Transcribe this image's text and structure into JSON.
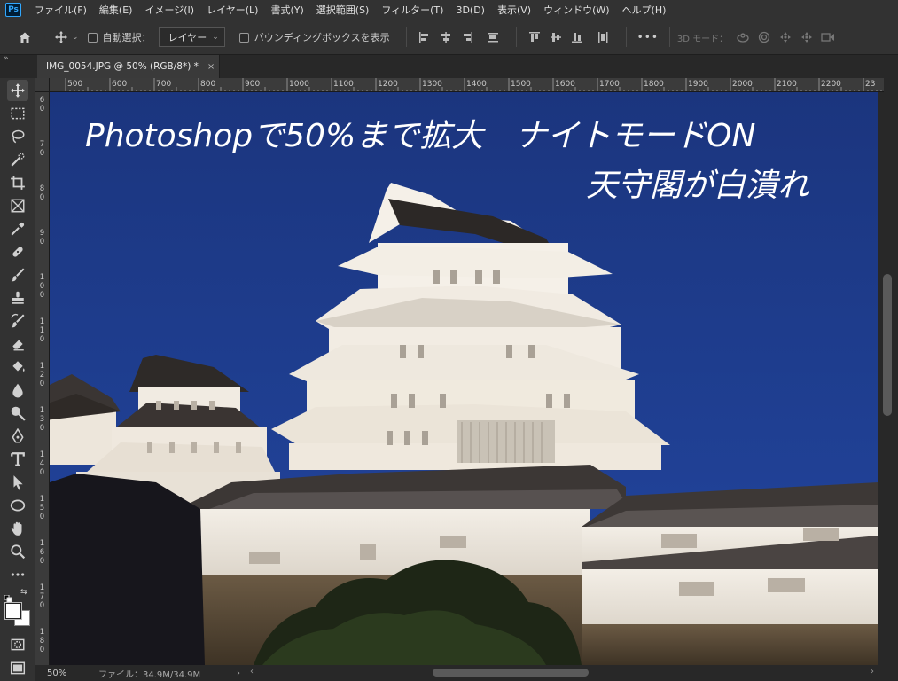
{
  "app": {
    "logo_text": "Ps",
    "menu": [
      "ファイル(F)",
      "編集(E)",
      "イメージ(I)",
      "レイヤー(L)",
      "書式(Y)",
      "選択範囲(S)",
      "フィルター(T)",
      "3D(D)",
      "表示(V)",
      "ウィンドウ(W)",
      "ヘルプ(H)"
    ]
  },
  "options": {
    "auto_select_label": "自動選択：",
    "auto_select_target": "レイヤー",
    "bounding_box_label": "バウンディングボックスを表示",
    "more": "•••",
    "mode_3d_label": "3D モード："
  },
  "document": {
    "tab_title": "IMG_0054.JPG @ 50% (RGB/8*) *",
    "close_glyph": "×",
    "overlay_title": "Photoshopで50%まで拡大　ナイトモードON",
    "overlay_subtitle": "天守閣が白潰れ"
  },
  "rulers": {
    "top_labels": [
      "500",
      "600",
      "700",
      "800",
      "900",
      "1000",
      "1100",
      "1200",
      "1300",
      "1400",
      "1500",
      "1600",
      "1700",
      "1800",
      "1900",
      "2000",
      "2100",
      "2200",
      "23"
    ],
    "left_labels": [
      {
        "digits": [
          "6",
          "0"
        ]
      },
      {
        "digits": [
          "7",
          "0"
        ]
      },
      {
        "digits": [
          "8",
          "0"
        ]
      },
      {
        "digits": [
          "9",
          "0"
        ]
      },
      {
        "digits": [
          "1",
          "0",
          "0"
        ]
      },
      {
        "digits": [
          "1",
          "1",
          "0"
        ]
      },
      {
        "digits": [
          "1",
          "2",
          "0"
        ]
      },
      {
        "digits": [
          "1",
          "3",
          "0"
        ]
      },
      {
        "digits": [
          "1",
          "4",
          "0"
        ]
      },
      {
        "digits": [
          "1",
          "5",
          "0"
        ]
      },
      {
        "digits": [
          "1",
          "6",
          "0"
        ]
      },
      {
        "digits": [
          "1",
          "7",
          "0"
        ]
      },
      {
        "digits": [
          "1",
          "8",
          "0"
        ]
      }
    ]
  },
  "status": {
    "zoom": "50%",
    "file_info": "ファイル：34.9M/34.9M",
    "arrow": "›"
  },
  "colors": {
    "sky": "#1d3a87",
    "ui_dark": "#323232",
    "castle_light": "#f1ece2"
  }
}
